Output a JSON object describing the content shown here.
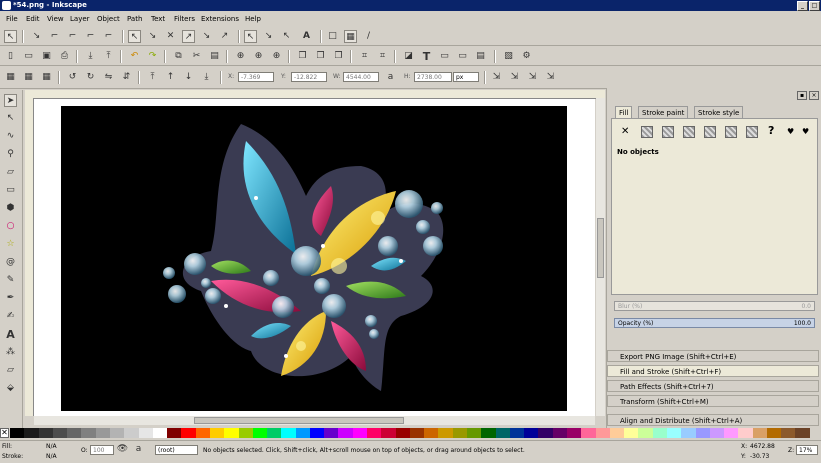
{
  "window": {
    "title": "*54.png - Inkscape",
    "controls": [
      "_",
      "□",
      "×"
    ]
  },
  "menu": [
    "File",
    "Edit",
    "View",
    "Layer",
    "Object",
    "Path",
    "Text",
    "Filters",
    "Extensions",
    "Help"
  ],
  "toolbar_controls": {
    "x_label": "X:",
    "x_value": "-7.369",
    "y_label": "Y:",
    "y_value": "-12.822",
    "w_label": "W:",
    "w_value": "4544.00",
    "h_label": "H:",
    "h_value": "2738.00",
    "unit": "px"
  },
  "fill_stroke": {
    "tabs": [
      "Fill",
      "Stroke paint",
      "Stroke style"
    ],
    "no_objects": "No objects",
    "blur_label": "Blur (%)",
    "blur_value": "0.0",
    "opacity_label": "Opacity (%)",
    "opacity_value": "100.0"
  },
  "dock_panels": [
    "Export PNG Image (Shift+Ctrl+E)",
    "Fill and Stroke (Shift+Ctrl+F)",
    "Path Effects  (Shift+Ctrl+7)",
    "Transform (Shift+Ctrl+M)",
    "Align and Distribute (Shift+Ctrl+A)"
  ],
  "palette_colors": [
    "#000000",
    "#1a1a1a",
    "#333333",
    "#4d4d4d",
    "#666666",
    "#808080",
    "#999999",
    "#b3b3b3",
    "#cccccc",
    "#e6e6e6",
    "#ffffff",
    "#800000",
    "#ff0000",
    "#ff6600",
    "#ffcc00",
    "#ffff00",
    "#99cc00",
    "#00ff00",
    "#00cc66",
    "#00ffff",
    "#0099ff",
    "#0000ff",
    "#6600cc",
    "#cc00ff",
    "#ff00ff",
    "#ff0066",
    "#cc0033",
    "#990000",
    "#993300",
    "#cc6600",
    "#cc9900",
    "#999900",
    "#669900",
    "#006600",
    "#006666",
    "#003399",
    "#000099",
    "#330066",
    "#660066",
    "#990066",
    "#ff6699",
    "#ff9999",
    "#ffcc99",
    "#ffff99",
    "#ccff99",
    "#99ffcc",
    "#99ffff",
    "#99ccff",
    "#9999ff",
    "#cc99ff",
    "#ff99ff",
    "#ffcccc",
    "#d9a066",
    "#b36b00",
    "#8c5a2b",
    "#6b4226"
  ],
  "status": {
    "fill_label": "Fill:",
    "fill_value": "N/A",
    "stroke_label": "Stroke:",
    "stroke_value": "N/A",
    "opacity_label": "O:",
    "opacity_value": "100",
    "layer": "(root)",
    "message": "No objects selected. Click, Shift+click, Alt+scroll mouse on top of objects, or drag around objects to select.",
    "x_label": "X:",
    "x_value": "4672.88",
    "y_label": "Y:",
    "y_value": "-30.73",
    "zoom_label": "Z:",
    "zoom_value": "17%"
  }
}
